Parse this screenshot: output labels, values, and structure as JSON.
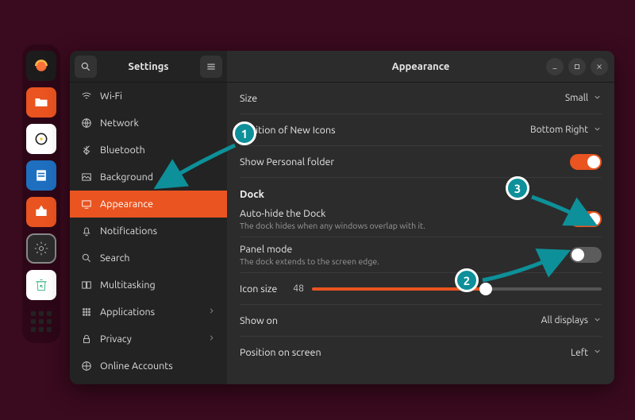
{
  "sidebar": {
    "title": "Settings",
    "items": [
      {
        "label": "Wi-Fi"
      },
      {
        "label": "Network"
      },
      {
        "label": "Bluetooth"
      },
      {
        "label": "Background"
      },
      {
        "label": "Appearance"
      },
      {
        "label": "Notifications"
      },
      {
        "label": "Search"
      },
      {
        "label": "Multitasking"
      },
      {
        "label": "Applications",
        "expand": true
      },
      {
        "label": "Privacy",
        "expand": true
      },
      {
        "label": "Online Accounts"
      }
    ]
  },
  "header": {
    "title": "Appearance"
  },
  "rows": {
    "size": {
      "label": "Size",
      "value": "Small"
    },
    "position_icons": {
      "label": "Position of New Icons",
      "value": "Bottom Right"
    },
    "personal_folder": {
      "label": "Show Personal folder"
    },
    "section_dock": "Dock",
    "autohide": {
      "label": "Auto-hide the Dock",
      "sub": "The dock hides when any windows overlap with it."
    },
    "panel": {
      "label": "Panel mode",
      "sub": "The dock extends to the screen edge."
    },
    "icon_size": {
      "label": "Icon size",
      "value": "48"
    },
    "show_on": {
      "label": "Show on",
      "value": "All displays"
    },
    "pos_screen": {
      "label": "Position on screen",
      "value": "Left"
    }
  },
  "annotations": {
    "b1": "1",
    "b2": "2",
    "b3": "3"
  }
}
